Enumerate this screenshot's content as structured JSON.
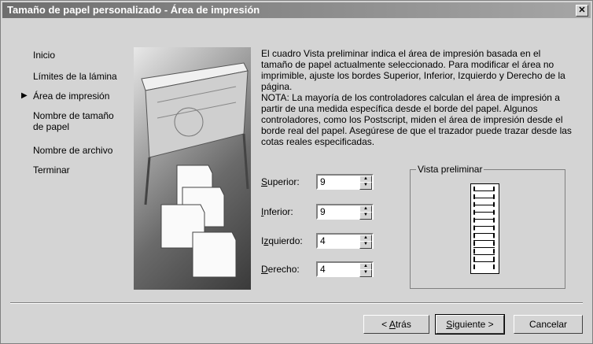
{
  "window": {
    "title": "Tamaño de papel personalizado - Área de impresión",
    "close_label": "✕"
  },
  "steps": {
    "current_marker": "▶",
    "items": [
      {
        "label": "Inicio"
      },
      {
        "label": "Límites de la lámina"
      },
      {
        "label": "Área de impresión",
        "current": true
      },
      {
        "label": "Nombre de tamaño de papel"
      },
      {
        "label": "Nombre de archivo"
      },
      {
        "label": "Terminar"
      }
    ],
    "multiline": {
      "name_line1": "Nombre de tamaño",
      "name_line2": "de papel"
    }
  },
  "description": {
    "paragraph1": "El cuadro Vista preliminar indica el área de impresión basada en el tamaño de papel actualmente seleccionado. Para modificar el área no imprimible, ajuste los bordes Superior, Inferior, Izquierdo y Derecho de la página.",
    "paragraph2": "NOTA: La mayoría de los controladores calculan el área de impresión a partir de una medida específica desde el borde del papel. Algunos controladores, como los Postscript, miden el área de impresión desde el borde real del papel. Asegúrese de que el trazador puede trazar desde las cotas reales especificadas."
  },
  "fields": {
    "superior": {
      "label_u": "S",
      "label_rest": "uperior:",
      "value": "9"
    },
    "inferior": {
      "label_u": "I",
      "label_rest": "nferior:",
      "value": "9"
    },
    "izquierdo": {
      "label_pre": "I",
      "label_u": "z",
      "label_rest": "quierdo:",
      "value": "4"
    },
    "derecho": {
      "label_u": "D",
      "label_rest": "erecho:",
      "value": "4"
    }
  },
  "preview": {
    "group_label": "Vista preliminar"
  },
  "buttons": {
    "back": {
      "pre": "< ",
      "u": "A",
      "rest": "trás"
    },
    "next": {
      "u": "S",
      "rest": "iguiente >"
    },
    "cancel": "Cancelar"
  },
  "colors": {
    "face": "#d4d4d4",
    "title_start": "#6e6e6e",
    "title_end": "#a6a6a6"
  }
}
